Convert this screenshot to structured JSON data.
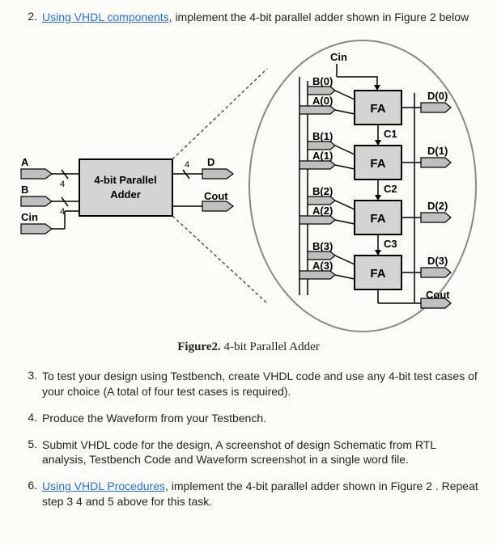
{
  "items": [
    {
      "number": "2.",
      "link": "Using VHDL components",
      "text_after_link": ", implement the 4-bit parallel adder shown in Figure 2 below",
      "faded_line": ""
    },
    {
      "number": "3.",
      "text": "To test your design using Testbench, create VHDL code and use any 4-bit test cases of your choice (A total of four test cases is required)."
    },
    {
      "number": "4.",
      "text": "Produce the Waveform from your Testbench."
    },
    {
      "number": "5.",
      "text": "Submit VHDL code for the design, A screenshot of design Schematic from RTL analysis, Testbench Code and Waveform screenshot in a single word file."
    },
    {
      "number": "6.",
      "link": "Using VHDL Procedures",
      "text_after_link": ", implement the 4-bit parallel adder shown in Figure 2 . Repeat step 3          4            and 5 above for this task."
    }
  ],
  "figure": {
    "caption_bold": "Figure2.",
    "caption_rest": " 4-bit Parallel Adder",
    "block_title_line1": "4-bit Parallel",
    "block_title_line2": "Adder",
    "left": {
      "A": "A",
      "B": "B",
      "Cin": "Cin",
      "D": "D",
      "Cout": "Cout",
      "buswidth": "4"
    },
    "right": {
      "Cin": "Cin",
      "FA": "FA",
      "signals": {
        "B0": "B(0)",
        "A0": "A(0)",
        "D0": "D(0)",
        "B1": "B(1)",
        "A1": "A(1)",
        "D1": "D(1)",
        "C1": "C1",
        "B2": "B(2)",
        "A2": "A(2)",
        "D2": "D(2)",
        "C2": "C2",
        "B3": "B(3)",
        "A3": "A(3)",
        "D3": "D(3)",
        "C3": "C3",
        "Cout": "Cout"
      }
    }
  }
}
